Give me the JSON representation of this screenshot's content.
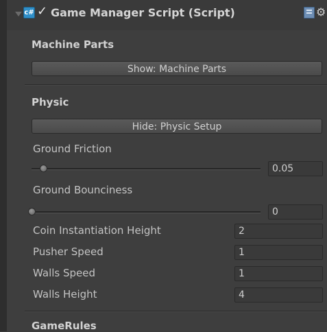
{
  "header": {
    "title": "Game Manager Script (Script)",
    "script_icon_glyph": "c#",
    "enabled_glyph": "✓",
    "icons": [
      "foldout-arrow-icon",
      "script-icon",
      "checkbox-icon",
      "book-icon",
      "gear-icon"
    ]
  },
  "machine_parts": {
    "title": "Machine Parts",
    "button_label": "Show: Machine Parts"
  },
  "physic": {
    "title": "Physic",
    "button_label": "Hide: Physic Setup",
    "ground_friction": {
      "label": "Ground Friction",
      "value": "0.05",
      "level": 0.05
    },
    "ground_bounciness": {
      "label": "Ground Bounciness",
      "value": "0",
      "level": 0.0
    },
    "fields": [
      {
        "label": "Coin Instantiation Height",
        "value": "2"
      },
      {
        "label": "Pusher Speed",
        "value": "1"
      },
      {
        "label": "Walls Speed",
        "value": "1"
      },
      {
        "label": "Walls Height",
        "value": "4"
      }
    ]
  },
  "game_rules": {
    "title": "GameRules"
  },
  "colors": {
    "panel_bg": "#3e3e3e",
    "script_icon": "#2f8fc9",
    "text": "#c8c8c8"
  }
}
